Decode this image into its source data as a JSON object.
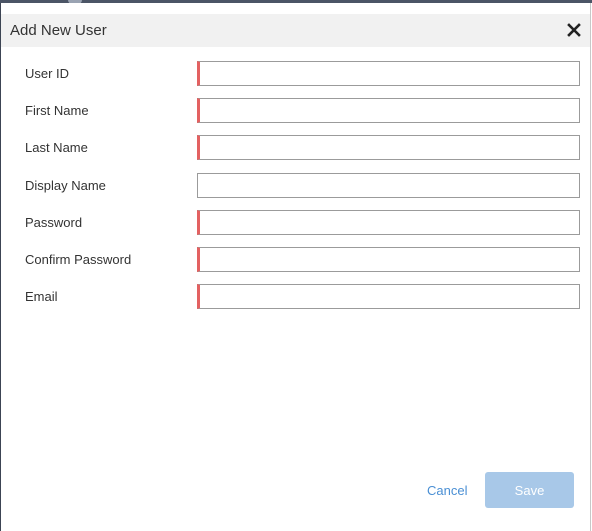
{
  "dialog": {
    "title": "Add New User",
    "close_icon": "close-icon"
  },
  "fields": [
    {
      "label": "User ID",
      "value": "",
      "required": true
    },
    {
      "label": "First Name",
      "value": "",
      "required": true
    },
    {
      "label": "Last Name",
      "value": "",
      "required": true
    },
    {
      "label": "Display Name",
      "value": "",
      "required": false
    },
    {
      "label": "Password",
      "value": "",
      "required": true
    },
    {
      "label": "Confirm Password",
      "value": "",
      "required": true
    },
    {
      "label": "Email",
      "value": "",
      "required": true
    }
  ],
  "footer": {
    "cancel_label": "Cancel",
    "save_label": "Save"
  },
  "colors": {
    "required_marker": "#e36161",
    "save_button": "#a8c8e8",
    "link": "#4a8fd4"
  }
}
